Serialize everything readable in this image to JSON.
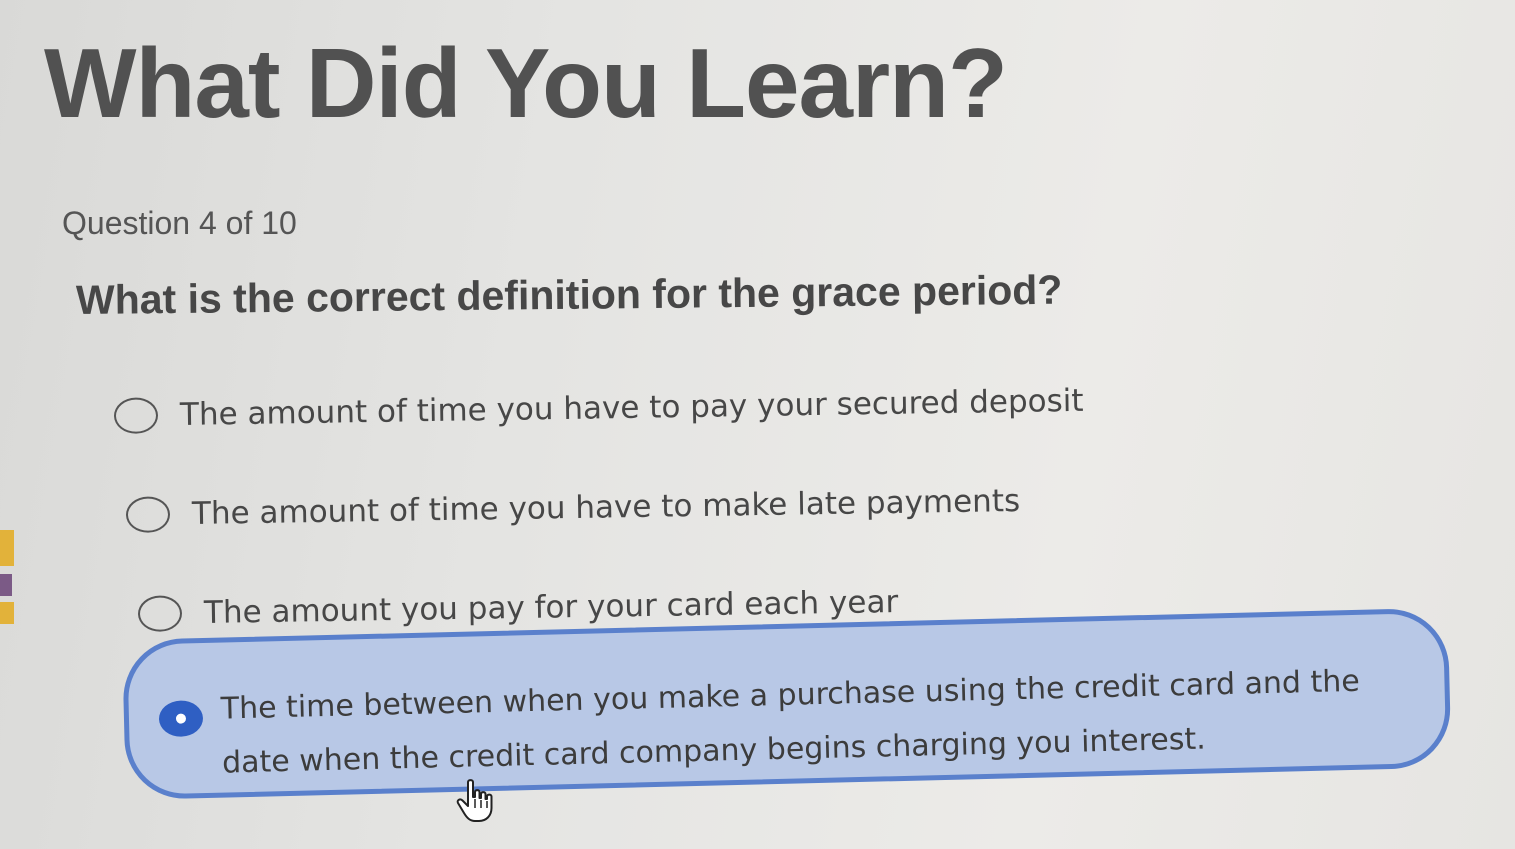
{
  "quiz": {
    "title": "What Did You Learn?",
    "counter": "Question 4 of 10",
    "question": "What is the correct definition for the grace period?",
    "options": [
      {
        "label": "The amount of time you have to pay your secured deposit",
        "selected": false
      },
      {
        "label": "The amount of time you have to make late payments",
        "selected": false
      },
      {
        "label": "The amount you pay for your card each year",
        "selected": false
      },
      {
        "label": "The time between when you make a purchase using the credit card and the date when the credit card company begins charging you interest.",
        "selected": true
      }
    ]
  },
  "colors": {
    "selected_fill": "#b8c8e6",
    "selected_border": "#5a80cc",
    "selected_radio": "#2f5fc3",
    "accent_yellow": "#e2b23a",
    "accent_purple": "#7b5a86"
  },
  "icons": {
    "cursor": "hand-pointer-icon"
  }
}
